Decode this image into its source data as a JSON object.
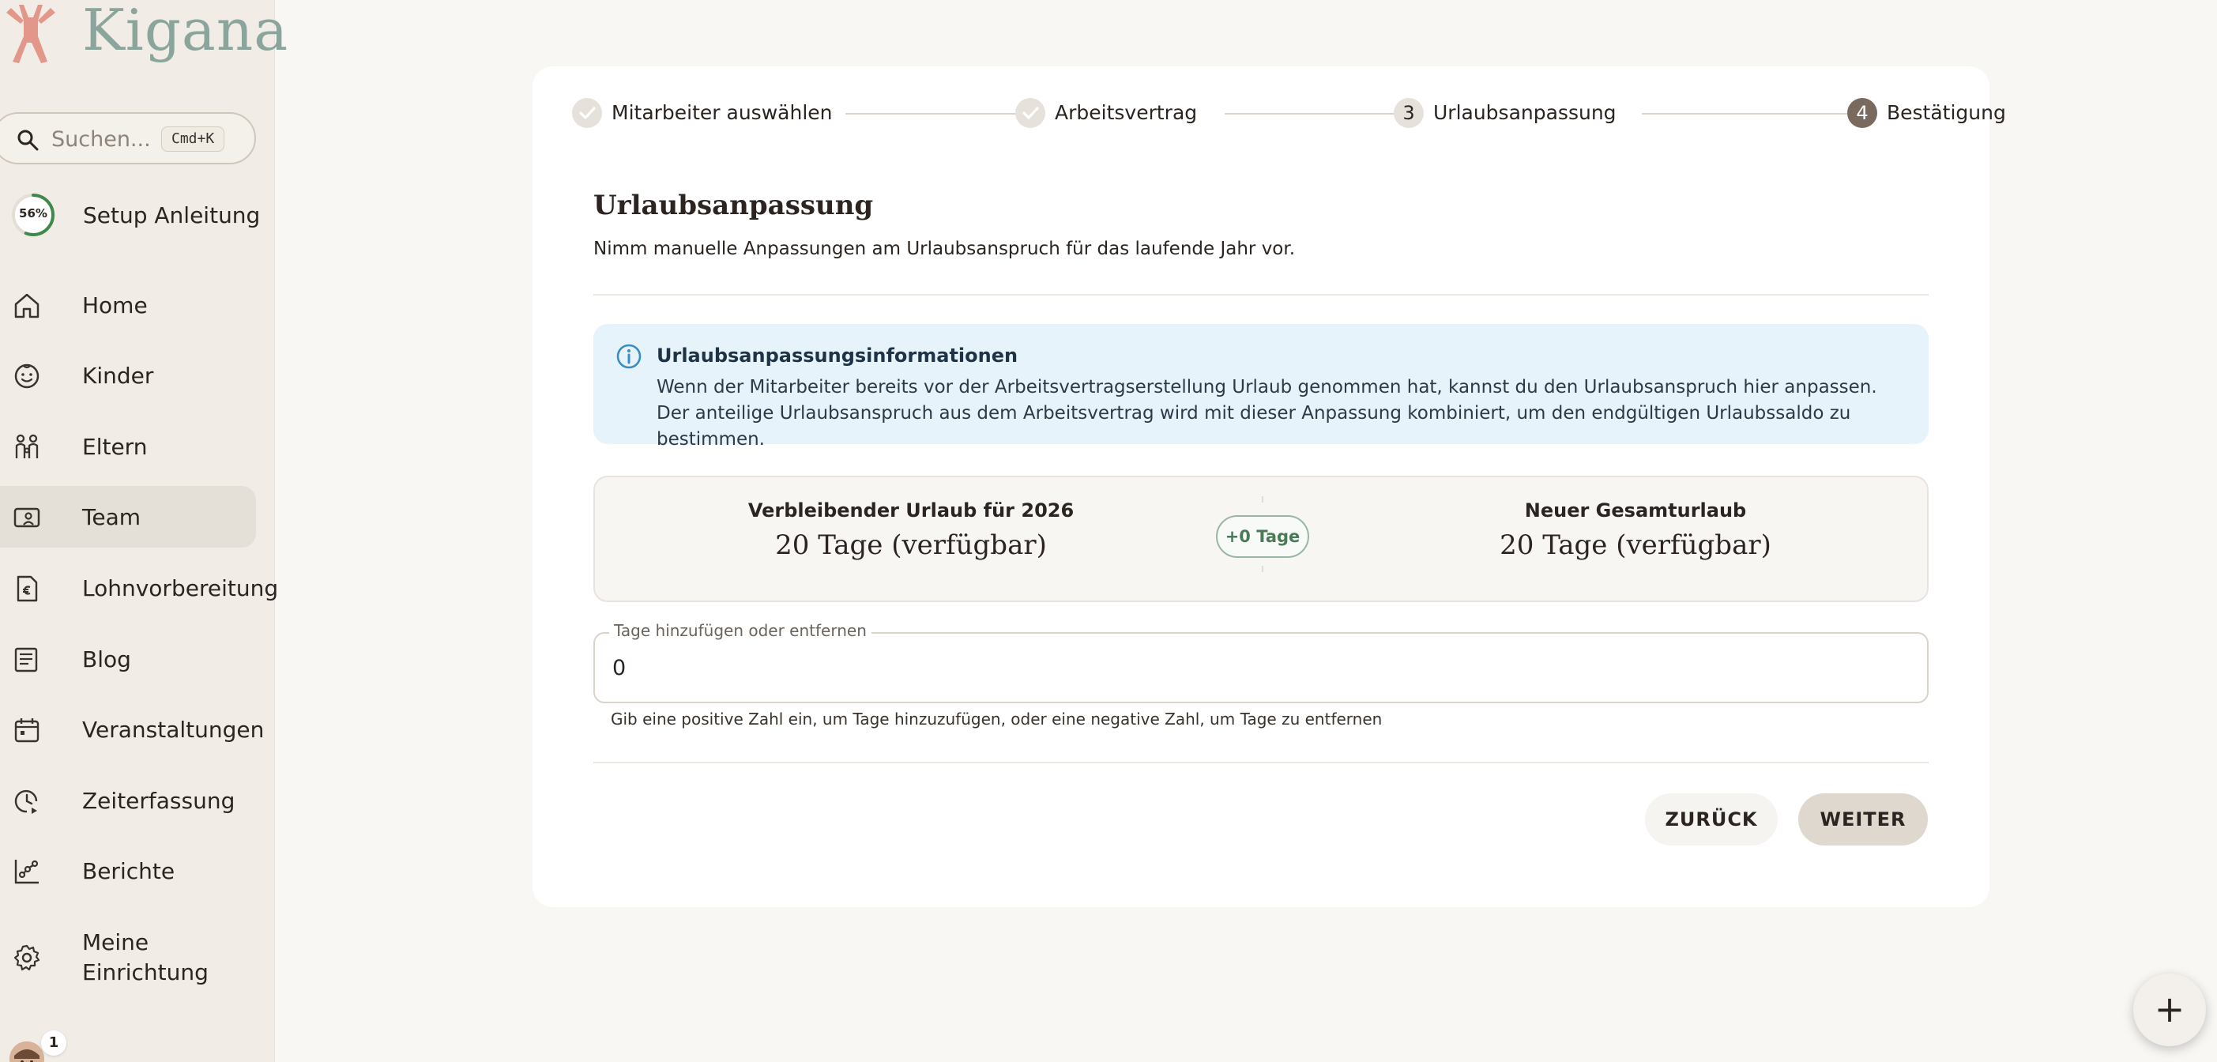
{
  "app": {
    "name": "Kigana"
  },
  "search": {
    "placeholder": "Suchen...",
    "shortcut": "Cmd+K"
  },
  "setup": {
    "progress": "56%",
    "progress_value": 0.56,
    "label": "Setup Anleitung"
  },
  "sidebar": {
    "items": [
      {
        "label": "Home",
        "icon": "home-icon"
      },
      {
        "label": "Kinder",
        "icon": "child-face-icon"
      },
      {
        "label": "Eltern",
        "icon": "parents-icon"
      },
      {
        "label": "Team",
        "icon": "team-badge-icon",
        "active": true
      },
      {
        "label": "Lohnvorbereitung",
        "icon": "payroll-icon"
      },
      {
        "label": "Blog",
        "icon": "blog-icon"
      },
      {
        "label": "Veranstaltungen",
        "icon": "calendar-icon"
      },
      {
        "label": "Zeiterfassung",
        "icon": "clock-icon"
      },
      {
        "label": "Berichte",
        "icon": "chart-icon"
      },
      {
        "label": "Meine Einrichtung",
        "icon": "gear-icon"
      }
    ],
    "notification_count": "1"
  },
  "stepper": {
    "steps": [
      {
        "number": "",
        "label": "Mitarbeiter auswählen",
        "state": "done"
      },
      {
        "number": "",
        "label": "Arbeitsvertrag",
        "state": "done"
      },
      {
        "number": "3",
        "label": "Urlaubsanpassung",
        "state": "current"
      },
      {
        "number": "4",
        "label": "Bestätigung",
        "state": "upcoming"
      }
    ]
  },
  "section": {
    "title": "Urlaubsanpassung",
    "subtitle": "Nimm manuelle Anpassungen am Urlaubsanspruch für das laufende Jahr vor."
  },
  "info": {
    "title": "Urlaubsanpassungsinformationen",
    "body": "Wenn der Mitarbeiter bereits vor der Arbeitsvertragserstellung Urlaub genommen hat, kannst du den Urlaubsanspruch hier anpassen. Der anteilige Urlaubsanspruch aus dem Arbeitsvertrag wird mit dieser Anpassung kombiniert, um den endgültigen Urlaubssaldo zu bestimmen."
  },
  "summary": {
    "remaining_label": "Verbleibender Urlaub für 2026",
    "remaining_value": "20 Tage (verfügbar)",
    "delta": "+0 Tage",
    "total_label": "Neuer Gesamturlaub",
    "total_value": "20 Tage (verfügbar)"
  },
  "adjust_field": {
    "label": "Tage hinzufügen oder entfernen",
    "value": "0",
    "help": "Gib eine positive Zahl ein, um Tage hinzuzufügen, oder eine negative Zahl, um Tage zu entfernen"
  },
  "actions": {
    "back": "ZURÜCK",
    "next": "WEITER"
  },
  "fab": {
    "label": "+"
  },
  "colors": {
    "sidebar_bg": "#f1ede6",
    "active_item_bg": "#e4dfd7",
    "logo_green": "#8aa59c",
    "logo_figure": "#e3968a",
    "info_bg": "#e6f3fa",
    "info_icon": "#3a8cc4",
    "pill_green": "#4b7a57",
    "progress_green": "#3f8a4a"
  }
}
